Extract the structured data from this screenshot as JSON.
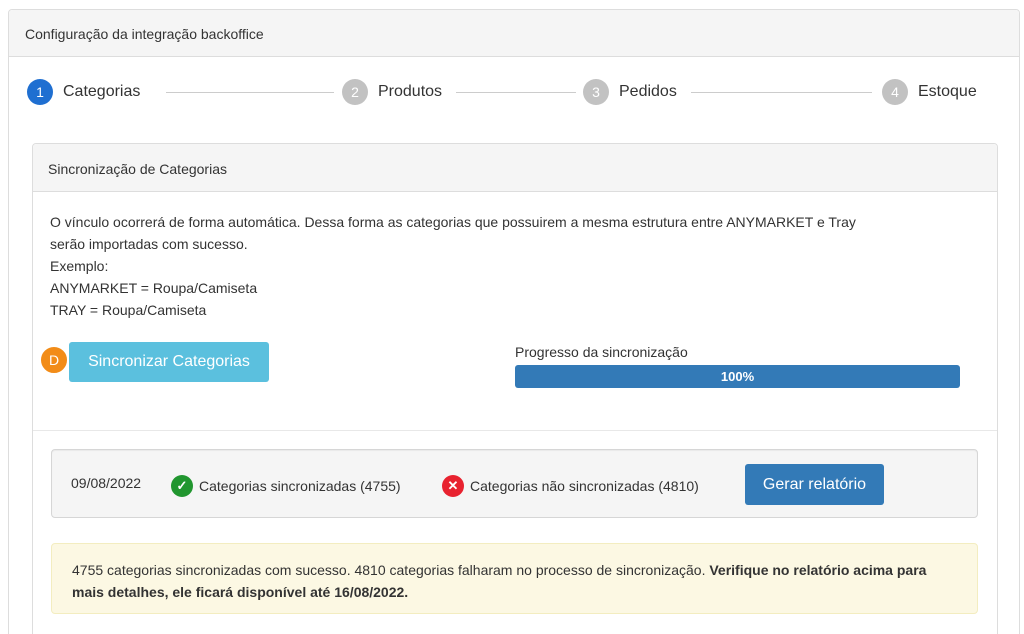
{
  "header": {
    "title": "Configuração da integração backoffice"
  },
  "steps": [
    {
      "num": "1",
      "label": "Categorias",
      "active": true
    },
    {
      "num": "2",
      "label": "Produtos",
      "active": false
    },
    {
      "num": "3",
      "label": "Pedidos",
      "active": false
    },
    {
      "num": "4",
      "label": "Estoque",
      "active": false
    }
  ],
  "panel": {
    "title": "Sincronização de Categorias",
    "description": [
      "O vínculo ocorrerá de forma automática. Dessa forma as categorias que possuirem a mesma estrutura entre ANYMARKET e Tray",
      "serão importadas com sucesso.",
      "Exemplo:",
      "ANYMARKET = Roupa/Camiseta",
      "TRAY = Roupa/Camiseta"
    ],
    "sync_button_label": "Sincronizar Categorias",
    "badge_letter": "D",
    "progress_label": "Progresso da sincronização",
    "progress_text": "100%",
    "progress_value": 100
  },
  "summary": {
    "date": "09/08/2022",
    "synced_label": "Categorias sincronizadas (4755)",
    "not_synced_label": "Categorias não sincronizadas (4810)",
    "report_button_label": "Gerar relatório",
    "synced_icon": "check-circle-icon",
    "not_synced_icon": "x-circle-icon"
  },
  "alert": {
    "text": "4755 categorias sincronizadas com sucesso. 4810 categorias falharam no processo de sincronização.",
    "bold_text": "Verifique no relatório acima para mais detalhes, ele ficará disponível até 16/08/2022."
  },
  "colors": {
    "step_active": "#1f6fd1",
    "step_inactive": "#c2c2c2",
    "sync_button": "#5bc0de",
    "progress_fill": "#337ab7",
    "report_button": "#337ab7",
    "success": "#21962f",
    "error": "#e8222f",
    "badge": "#f28c18",
    "alert_bg": "#fcf8e3"
  }
}
